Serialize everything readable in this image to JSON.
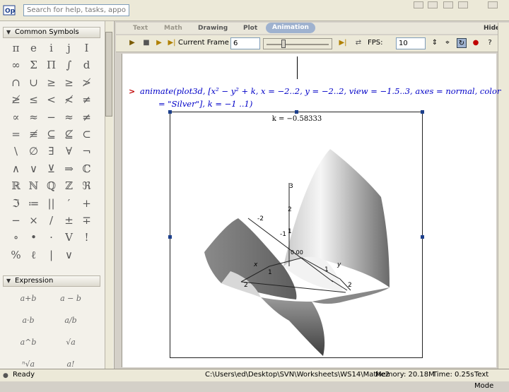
{
  "help_search": {
    "placeholder": "Search for help, tasks, appo..."
  },
  "palettes": {
    "common_symbols": {
      "title": "Common Symbols",
      "symbols": [
        "π",
        "e",
        "i",
        "j",
        "I",
        "∞",
        "Σ",
        "Π",
        "∫",
        "d",
        "∩",
        "∪",
        "≥",
        "≥",
        "≯",
        "≱",
        "≤",
        "<",
        "≮",
        "≠",
        "∝",
        "≈",
        "−",
        "≈",
        "≠",
        "=",
        "≢",
        "⊆",
        "⊈",
        "⊂",
        "\\",
        "∅",
        "∃",
        "∀",
        "¬",
        "∧",
        "∨",
        "⊻",
        "⇒",
        "ℂ",
        "ℝ",
        "ℕ",
        "ℚ",
        "ℤ",
        "ℜ",
        "ℑ",
        "≔",
        "||",
        "′",
        "+",
        "−",
        "×",
        "/",
        "±",
        "∓",
        "∘",
        "•",
        "·",
        "V",
        "!",
        "%",
        "ℓ",
        "|",
        "∨"
      ]
    },
    "expression": {
      "title": "Expression",
      "items": [
        "a+b",
        "a − b",
        "a·b",
        "a/b",
        "a^b",
        "√a",
        "ⁿ√a",
        "a!"
      ]
    }
  },
  "context_tabs": {
    "text": "Text",
    "math": "Math",
    "drawing": "Drawing",
    "plot": "Plot",
    "animation": "Animation",
    "hide": "Hide"
  },
  "animation_toolbar": {
    "current_frame_label": "Current Frame",
    "current_frame_value": "6",
    "slider_fraction": 0.25,
    "fps_label": "FPS:",
    "fps_value": "10"
  },
  "worksheet": {
    "prompt": ">",
    "command_line1": "animate(plot3d, [x² − y² + k, x = −2..2, y = −2..2, view = −1.5..3, axes = normal, color",
    "command_line2": "= \"Silver\"], k = −1 ..1)",
    "plot": {
      "frame_label": "k = −0.58333",
      "z_ticks": [
        "3",
        "2",
        "1"
      ],
      "x_ticks": [
        "-2",
        "-1",
        "1",
        "2"
      ],
      "y_ticks": [
        "1",
        "2"
      ],
      "x_axis_label": "x",
      "y_axis_label": "y",
      "origin_label": "0.00"
    }
  },
  "status_bar": {
    "ready": "Ready",
    "path": "C:\\Users\\ed\\Desktop\\SVN\\Worksheets\\WS14\\Mathe2",
    "memory": "Memory: 20.18M",
    "time": "Time: 0.25s",
    "mode": "Text Mode"
  },
  "colors": {
    "prompt_red": "#c00000",
    "math_blue": "#0000c8",
    "animation_tab": "#9fb2cf",
    "surface_dark": "#6e6e6e",
    "surface_light": "#f4f4f4"
  }
}
